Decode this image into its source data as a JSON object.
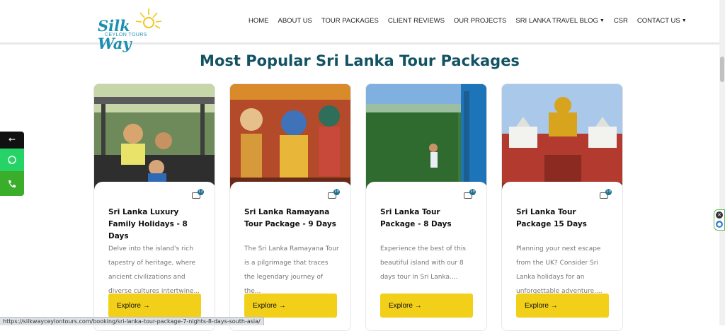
{
  "logo": {
    "name": "Silk Way",
    "subtitle": "CEYLON TOURS"
  },
  "nav": [
    {
      "label": "HOME",
      "dropdown": false
    },
    {
      "label": "ABOUT US",
      "dropdown": false
    },
    {
      "label": "TOUR PACKAGES",
      "dropdown": false
    },
    {
      "label": "CLIENT REVIEWS",
      "dropdown": false
    },
    {
      "label": "OUR PROJECTS",
      "dropdown": false
    },
    {
      "label": "SRI LANKA TRAVEL BLOG",
      "dropdown": true
    },
    {
      "label": "CSR",
      "dropdown": false
    },
    {
      "label": "CONTACT US",
      "dropdown": true
    }
  ],
  "section_title": "Most Popular Sri Lanka Tour Packages",
  "cards": [
    {
      "title": "Sri Lanka Luxury Family Holidays - 8 Days",
      "desc": "Delve into the island's rich tapestry of heritage, where ancient civilizations and diverse cultures intertwine...",
      "photo_count": "12",
      "button": "Explore"
    },
    {
      "title": "Sri Lanka Ramayana Tour Package - 9 Days",
      "desc": "The Sri Lanka Ramayana Tour is a pilgrimage that traces the legendary journey of the...",
      "photo_count": "10",
      "button": "Explore"
    },
    {
      "title": "Sri Lanka Tour Package - 8 Days",
      "desc": "Experience the best of this beautiful island with our 8 days tour in Sri Lanka....",
      "photo_count": "10",
      "button": "Explore"
    },
    {
      "title": "Sri Lanka Tour Package 15 Days",
      "desc": "Planning your next escape from the UK? Consider Sri Lanka holidays for an unforgettable adventure....",
      "photo_count": "10",
      "button": "Explore"
    }
  ],
  "side_buttons": {
    "back": "←",
    "whatsapp": "whatsapp-icon",
    "phone": "phone-icon"
  },
  "status_url": "https://silkwayceylontours.com/booking/sri-lanka-tour-package-7-nights-8-days-south-asia/",
  "colors": {
    "accent": "#125262",
    "button": "#f2d019",
    "whatsapp": "#25d366",
    "phone": "#3aae2a"
  }
}
